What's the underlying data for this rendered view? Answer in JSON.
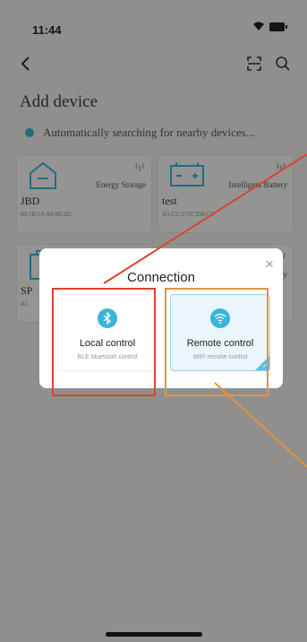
{
  "status_bar": {
    "time": "11:44"
  },
  "page": {
    "title": "Add device",
    "searching_text": "Automatically searching for nearby devices..."
  },
  "devices": [
    {
      "name": "JBD",
      "type": "Energy Storage",
      "mac": "00:1B:10:A0:00:2D"
    },
    {
      "name": "test",
      "type": "Intelligent Battery",
      "mac": "A5:C2:37:07:D8:C1"
    },
    {
      "name": "SP",
      "type": "",
      "mac": "A5"
    },
    {
      "name": "",
      "type": "ry",
      "mac": ""
    }
  ],
  "dialog": {
    "title": "Connection",
    "options": [
      {
        "label": "Local control",
        "sub": "BLE bluetooth control",
        "icon": "bluetooth-icon"
      },
      {
        "label": "Remote control",
        "sub": "WiFi remote control",
        "icon": "wifi-icon",
        "selected": true
      }
    ]
  },
  "annotation_colors": {
    "red": "#d9442e",
    "orange": "#e8913d"
  }
}
